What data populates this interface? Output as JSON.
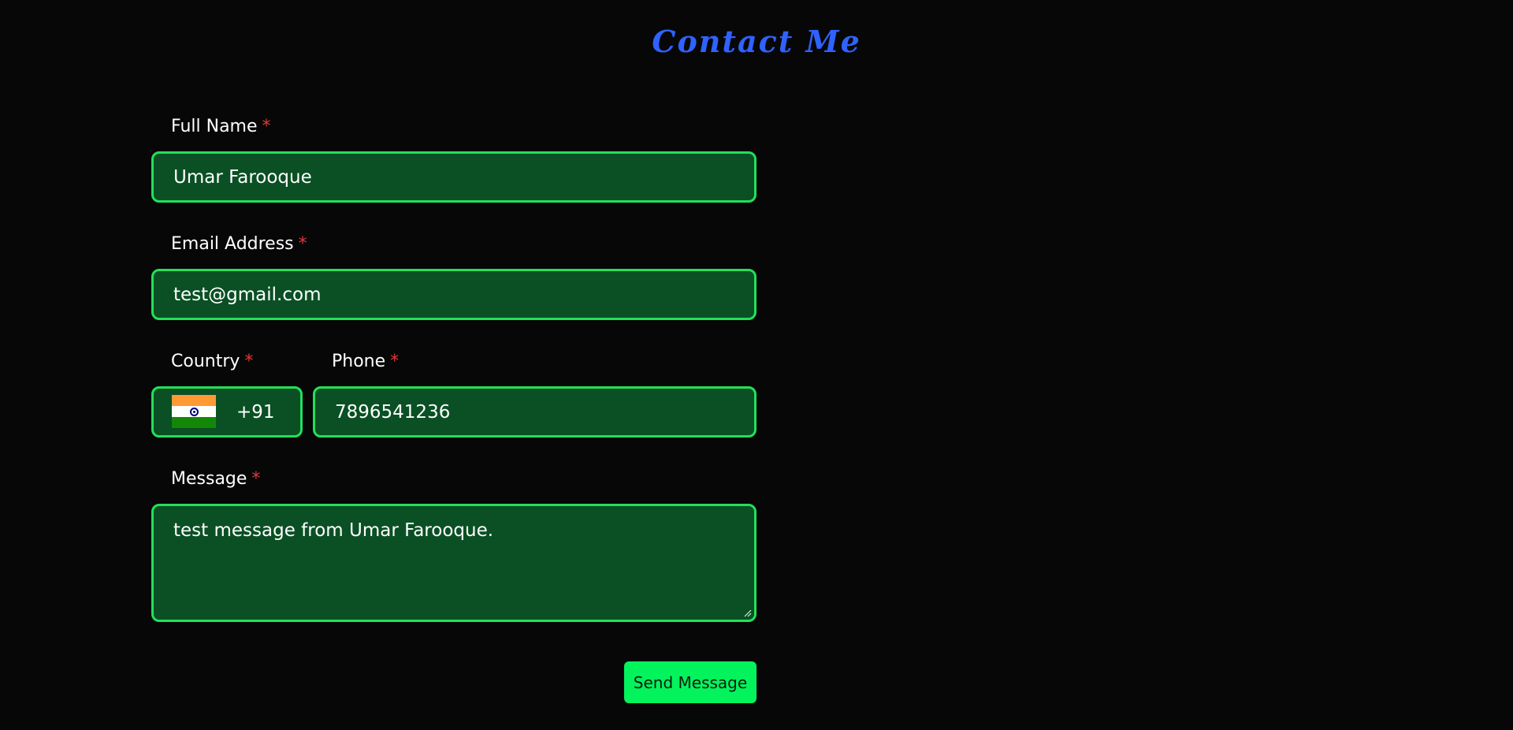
{
  "title": "Contact Me",
  "form": {
    "full_name": {
      "label": "Full Name",
      "required_mark": "*",
      "value": "Umar Farooque"
    },
    "email": {
      "label": "Email Address",
      "required_mark": "*",
      "value": "test@gmail.com"
    },
    "country": {
      "label": "Country",
      "required_mark": "*",
      "flag": "india-flag-icon",
      "code": "+91"
    },
    "phone": {
      "label": "Phone",
      "required_mark": "*",
      "value": "7896541236"
    },
    "message": {
      "label": "Message",
      "required_mark": "*",
      "value": "test message from Umar Farooque."
    },
    "submit_label": "Send Message"
  },
  "colors": {
    "background": "#070707",
    "title": "#2f62ff",
    "field_bg": "#0a5024",
    "field_border": "#22e05a",
    "required": "#e0383a",
    "button": "#03f35d"
  }
}
